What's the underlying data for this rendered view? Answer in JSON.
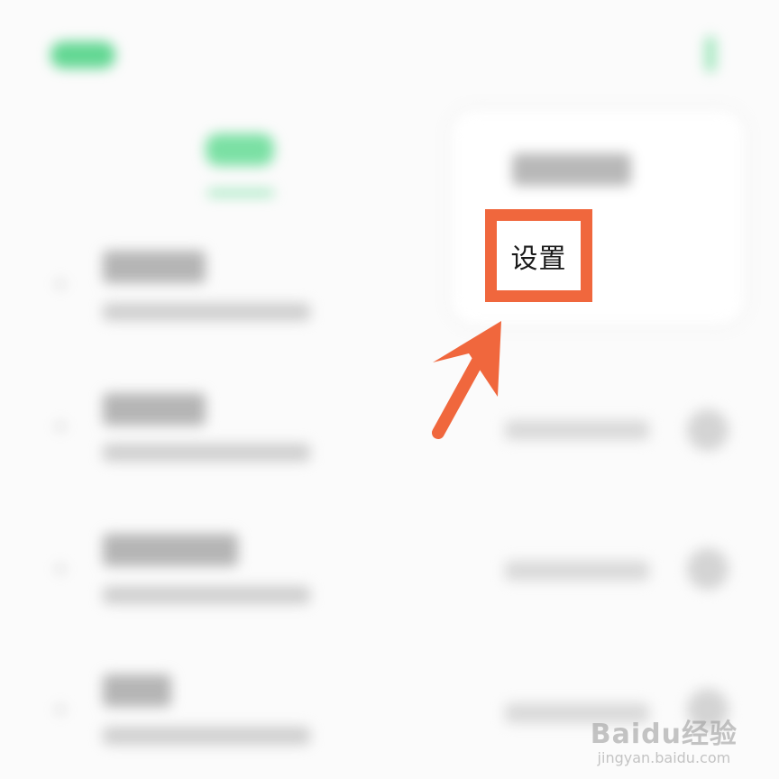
{
  "highlight": {
    "label": "设置",
    "color": "#f0673d"
  },
  "accent": "#3ccc7a",
  "watermark": {
    "brand": "Baidu经验",
    "url": "jingyan.baidu.com"
  },
  "icons": {
    "pointer": "arrow-up-right-icon",
    "logo": "baidu-paw-icon"
  }
}
